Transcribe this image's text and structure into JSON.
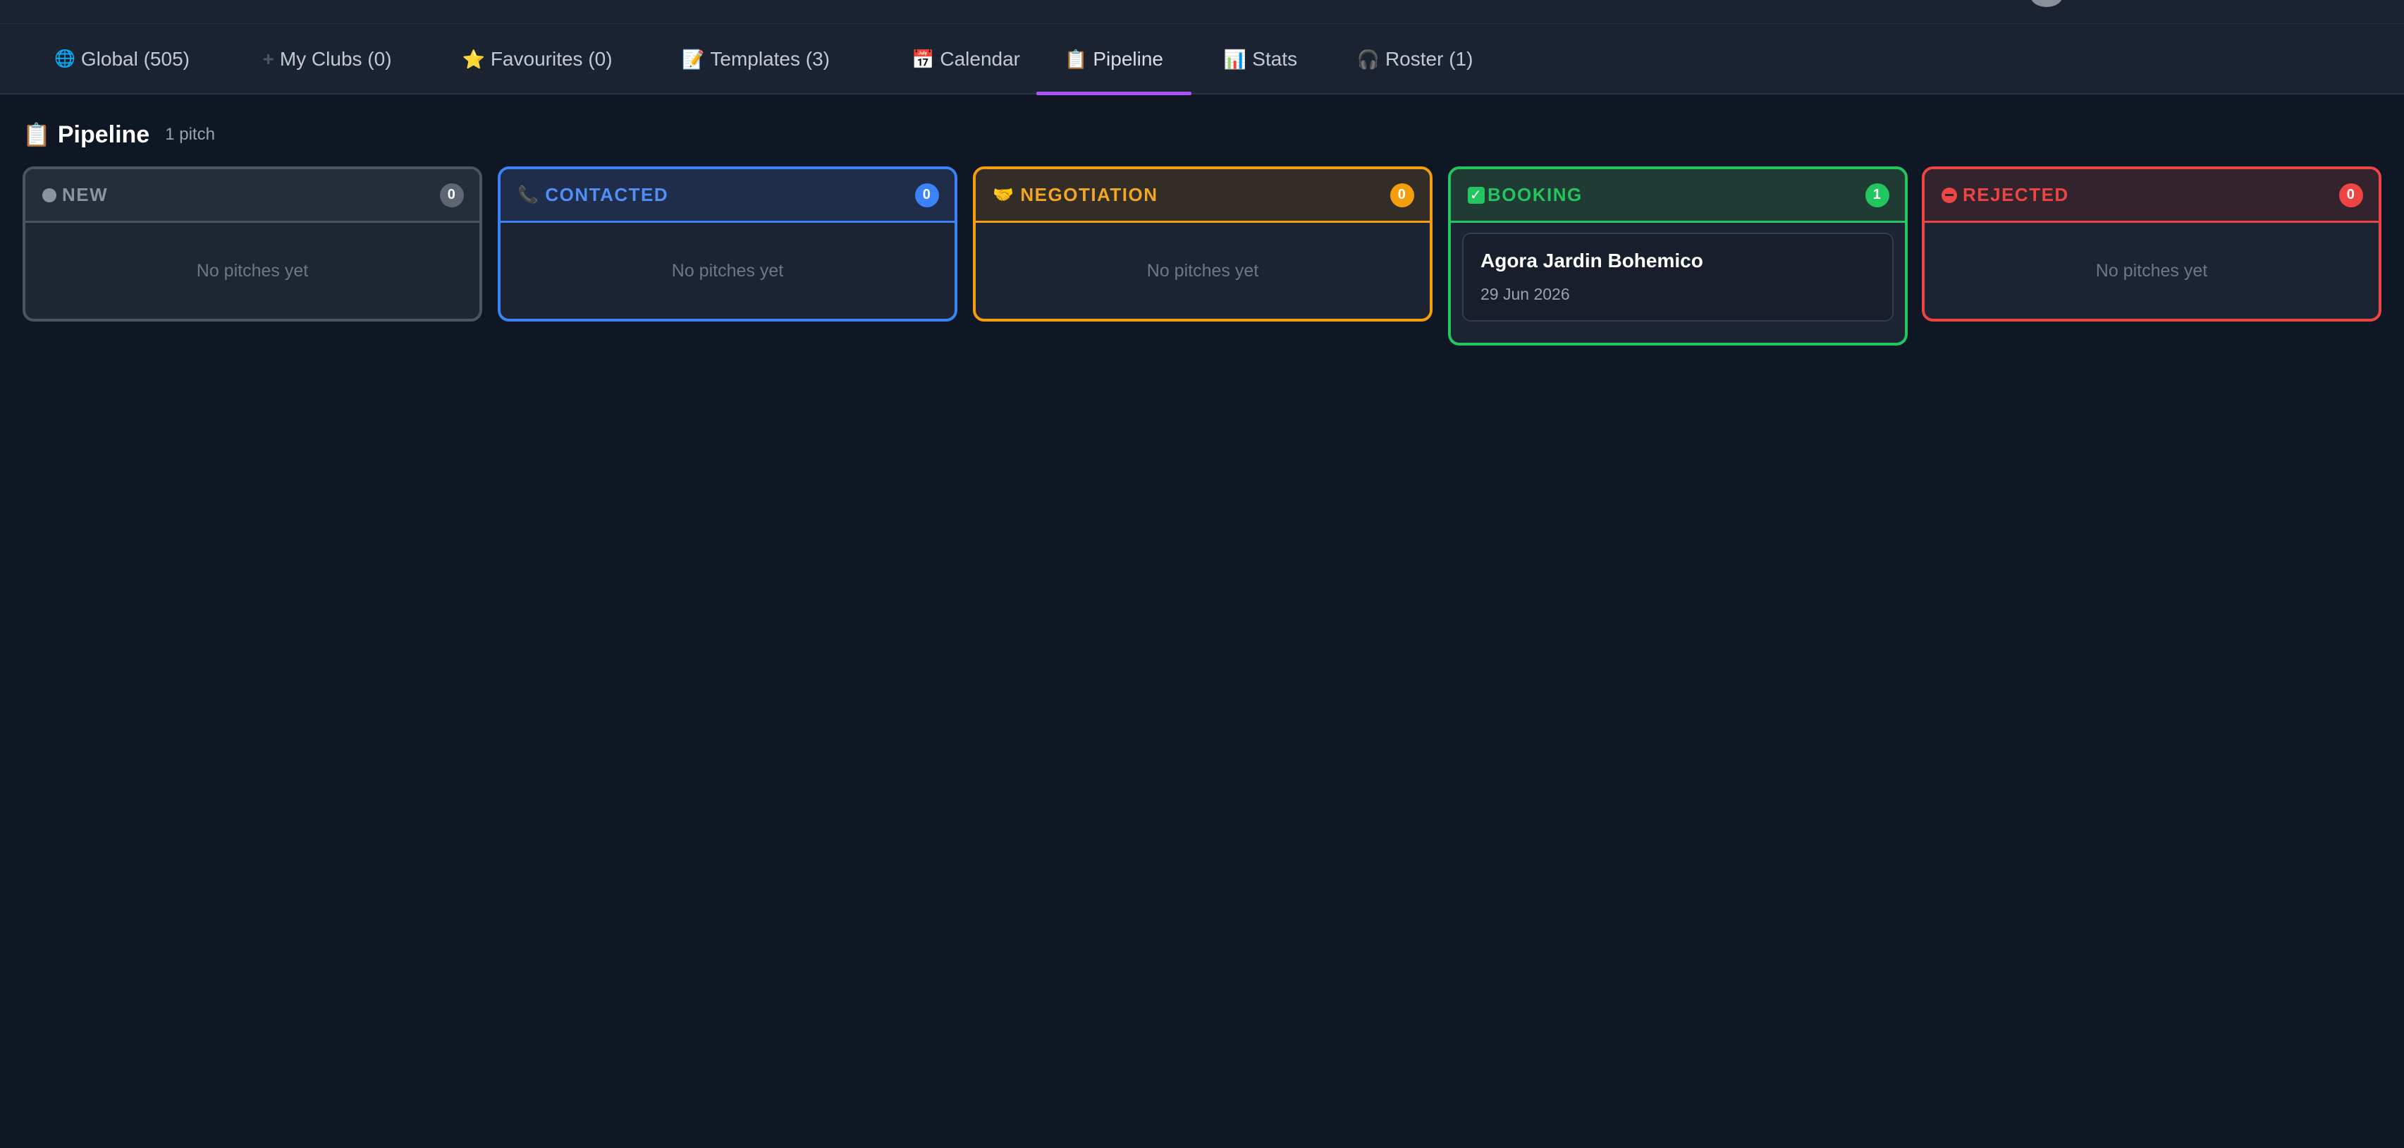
{
  "tabs": [
    {
      "icon": "globe-icon",
      "glyph": "🌐",
      "label": "Global (505)",
      "active": false
    },
    {
      "icon": "plus-icon",
      "glyph": "➕",
      "label": "My Clubs (0)",
      "active": false
    },
    {
      "icon": "star-icon",
      "glyph": "⭐",
      "label": "Favourites (0)",
      "active": false
    },
    {
      "icon": "memo-icon",
      "glyph": "📝",
      "label": "Templates (3)",
      "active": false
    },
    {
      "icon": "calendar-icon",
      "glyph": "📅",
      "label": "Calendar",
      "active": false
    },
    {
      "icon": "clipboard-icon",
      "glyph": "📋",
      "label": "Pipeline",
      "active": true
    },
    {
      "icon": "bar-chart-icon",
      "glyph": "📊",
      "label": "Stats",
      "active": false
    },
    {
      "icon": "headphones-icon",
      "glyph": "🎧",
      "label": "Roster (1)",
      "active": false
    }
  ],
  "page": {
    "icon": "clipboard-icon",
    "title": "Pipeline",
    "count_label": "1 pitch"
  },
  "accent": "#a855f7",
  "columns": [
    {
      "key": "new",
      "label": "NEW",
      "icon": "grey-dot-icon",
      "count": "0",
      "color": "#5f6673",
      "text_color": "#8b93a1",
      "empty_text": "No pitches yet"
    },
    {
      "key": "contacted",
      "label": "CONTACTED",
      "icon": "phone-icon",
      "count": "0",
      "color": "#3b82f6",
      "text_color": "#4f8ff7",
      "empty_text": "No pitches yet"
    },
    {
      "key": "negotiation",
      "label": "NEGOTIATION",
      "icon": "handshake-icon",
      "count": "0",
      "color": "#f59e0b",
      "text_color": "#f5a524",
      "empty_text": "No pitches yet"
    },
    {
      "key": "booking",
      "label": "BOOKING",
      "icon": "check-box-icon",
      "count": "1",
      "color": "#22c55e",
      "text_color": "#22c55e",
      "cards": [
        {
          "name": "Agora Jardin Bohemico",
          "date": "29 Jun 2026"
        }
      ]
    },
    {
      "key": "rejected",
      "label": "REJECTED",
      "icon": "minus-circle-icon",
      "count": "0",
      "color": "#ef4444",
      "text_color": "#ef4444",
      "empty_text": "No pitches yet"
    }
  ]
}
